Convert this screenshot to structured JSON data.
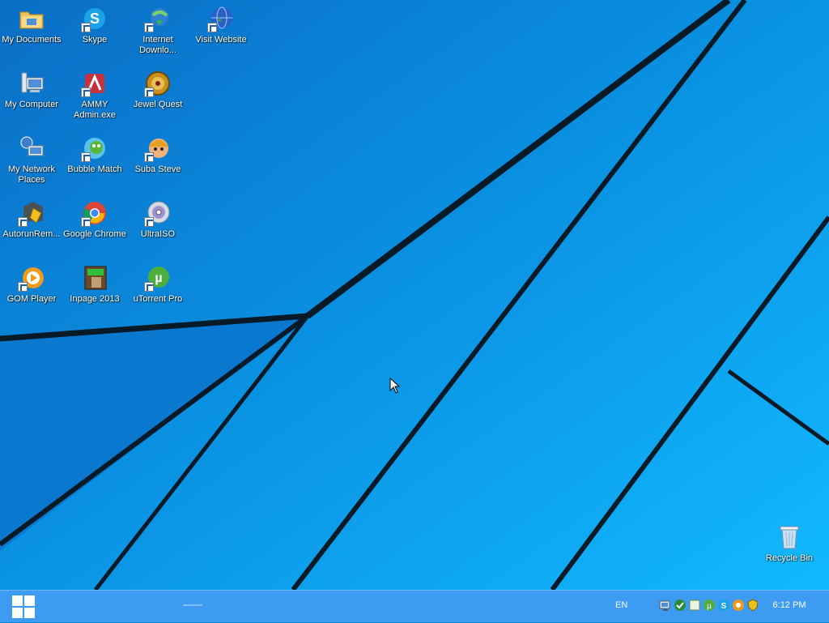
{
  "desktop": {
    "icons": [
      {
        "id": "my-documents",
        "label": "My Documents"
      },
      {
        "id": "skype",
        "label": "Skype"
      },
      {
        "id": "internet-download",
        "label": "Internet Downlo..."
      },
      {
        "id": "visit-website",
        "label": "Visit Website"
      },
      {
        "id": "my-computer",
        "label": "My Computer"
      },
      {
        "id": "ammy-admin",
        "label": "AMMY Admin.exe"
      },
      {
        "id": "jewel-quest",
        "label": "Jewel Quest"
      },
      {
        "id": "my-network-places",
        "label": "My Network Places"
      },
      {
        "id": "bubble-match",
        "label": "Bubble Match"
      },
      {
        "id": "suba-steve",
        "label": "Suba Steve"
      },
      {
        "id": "autorun-remover",
        "label": "AutorunRem..."
      },
      {
        "id": "google-chrome",
        "label": "Google Chrome"
      },
      {
        "id": "ultraiso",
        "label": "UltraISO"
      },
      {
        "id": "gom-player",
        "label": "GOM Player"
      },
      {
        "id": "inpage-2013",
        "label": "Inpage 2013"
      },
      {
        "id": "utorrent-pro",
        "label": "uTorrent Pro"
      },
      {
        "id": "recycle-bin",
        "label": "Recycle Bin"
      }
    ]
  },
  "taskbar": {
    "language": "EN",
    "clock": "6:12 PM",
    "tray_icons": [
      "network-icon",
      "shield-green-icon",
      "notes-icon",
      "utorrent-icon",
      "skype-status-icon",
      "gom-icon",
      "antivirus-icon"
    ]
  },
  "colors": {
    "taskbar": "#3d9cf2",
    "wallpaper_light": "#10b6ff",
    "wallpaper_dark": "#0a6ec2",
    "line": "#071a28"
  }
}
